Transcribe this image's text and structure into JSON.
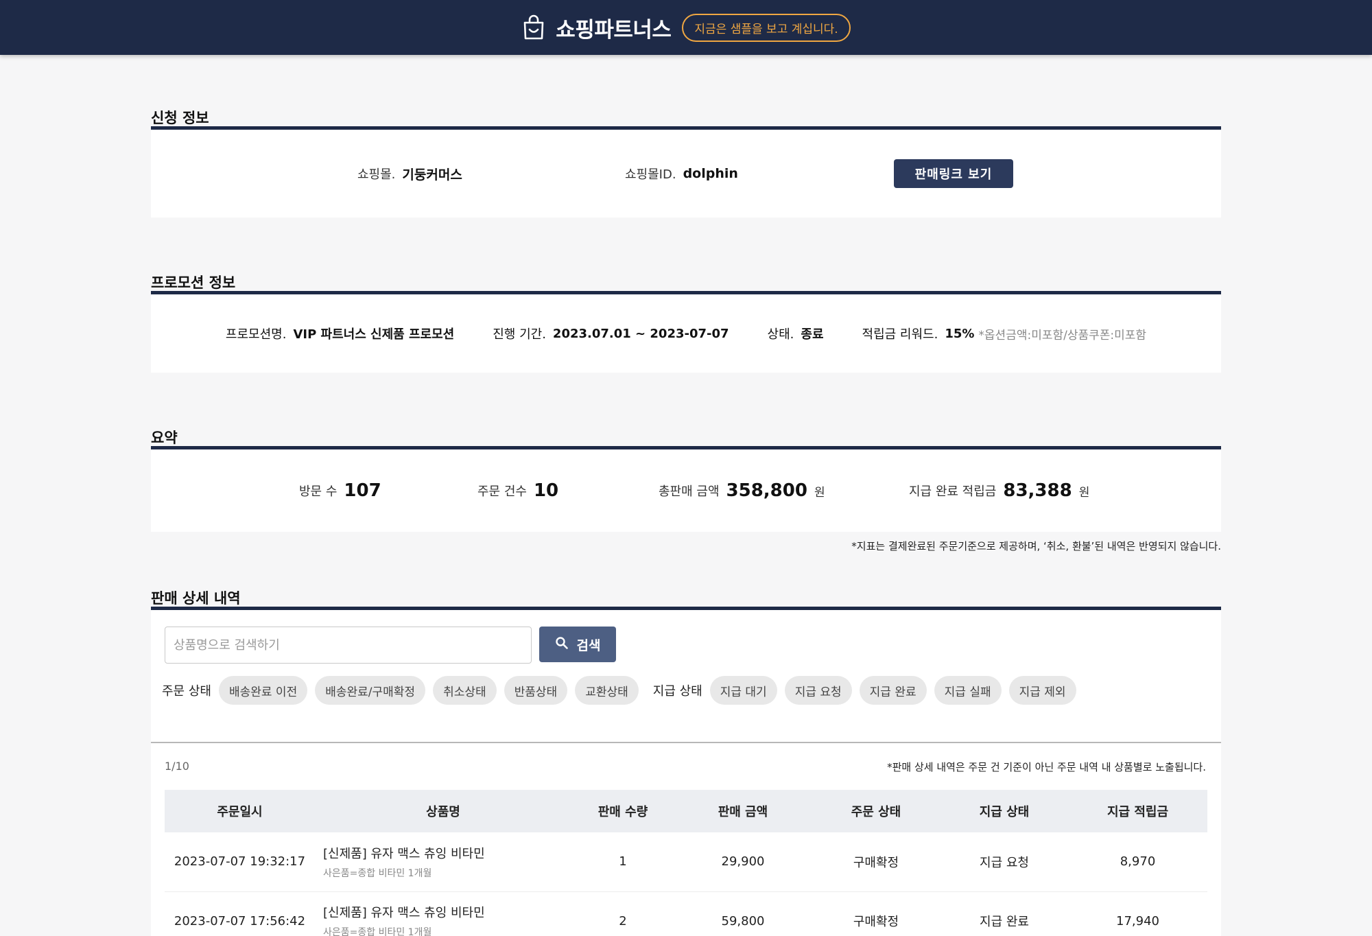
{
  "header": {
    "brand": "쇼핑파트너스",
    "sample_badge": "지금은 샘플을 보고 계십니다."
  },
  "application": {
    "title": "신청 정보",
    "mall_label": "쇼핑몰.",
    "mall_value": "기둥커머스",
    "mall_id_label": "쇼핑몰ID.",
    "mall_id_value": "dolphin",
    "sales_link_button": "판매링크 보기"
  },
  "promotion": {
    "title": "프로모션 정보",
    "name_label": "프로모션명.",
    "name_value": "VIP 파트너스 신제품 프로모션",
    "period_label": "진행 기간.",
    "period_value": "2023.07.01 ~ 2023-07-07",
    "status_label": "상태.",
    "status_value": "종료",
    "reward_label": "적립금 리워드.",
    "reward_value": "15%",
    "reward_note": "*옵션금액:미포함/상품쿠폰:미포함"
  },
  "summary": {
    "title": "요약",
    "visits_label": "방문 수",
    "visits_value": "107",
    "orders_label": "주문 건수",
    "orders_value": "10",
    "sales_label": "총판매 금액",
    "sales_value": "358,800",
    "sales_unit": "원",
    "paid_label": "지급 완료 적립금",
    "paid_value": "83,388",
    "paid_unit": "원",
    "note": "*지표는 결제완료된 주문기준으로 제공하며, ‘취소, 환불’된 내역은 반영되지 않습니다."
  },
  "details": {
    "title": "판매 상세 내역",
    "search_placeholder": "상품명으로 검색하기",
    "search_button": "검색",
    "order_status_label": "주문 상태",
    "order_status_chips": [
      "배송완료 이전",
      "배송완료/구매확정",
      "취소상태",
      "반품상태",
      "교환상태"
    ],
    "pay_status_label": "지급 상태",
    "pay_status_chips": [
      "지급 대기",
      "지급 요청",
      "지급 완료",
      "지급 실패",
      "지급 제외"
    ],
    "page_count": "1/10",
    "table_note": "*판매 상세 내역은 주문 건 기준이 아닌 주문 내역 내 상품별로 노출됩니다.",
    "columns": [
      "주문일시",
      "상품명",
      "판매 수량",
      "판매 금액",
      "주문 상태",
      "지급 상태",
      "지급 적립금"
    ],
    "rows": [
      {
        "date": "2023-07-07 19:32:17",
        "product": "[신제품] 유자 맥스 츄잉 비타민",
        "gift": "사은품=종합 비타민 1개월",
        "qty": "1",
        "amount": "29,900",
        "order_status": "구매확정",
        "pay_status": "지급 요청",
        "reward": "8,970"
      },
      {
        "date": "2023-07-07 17:56:42",
        "product": "[신제품] 유자 맥스 츄잉 비타민",
        "gift": "사은품=종합 비타민 1개월",
        "qty": "2",
        "amount": "59,800",
        "order_status": "구매확정",
        "pay_status": "지급 완료",
        "reward": "17,940"
      }
    ]
  }
}
